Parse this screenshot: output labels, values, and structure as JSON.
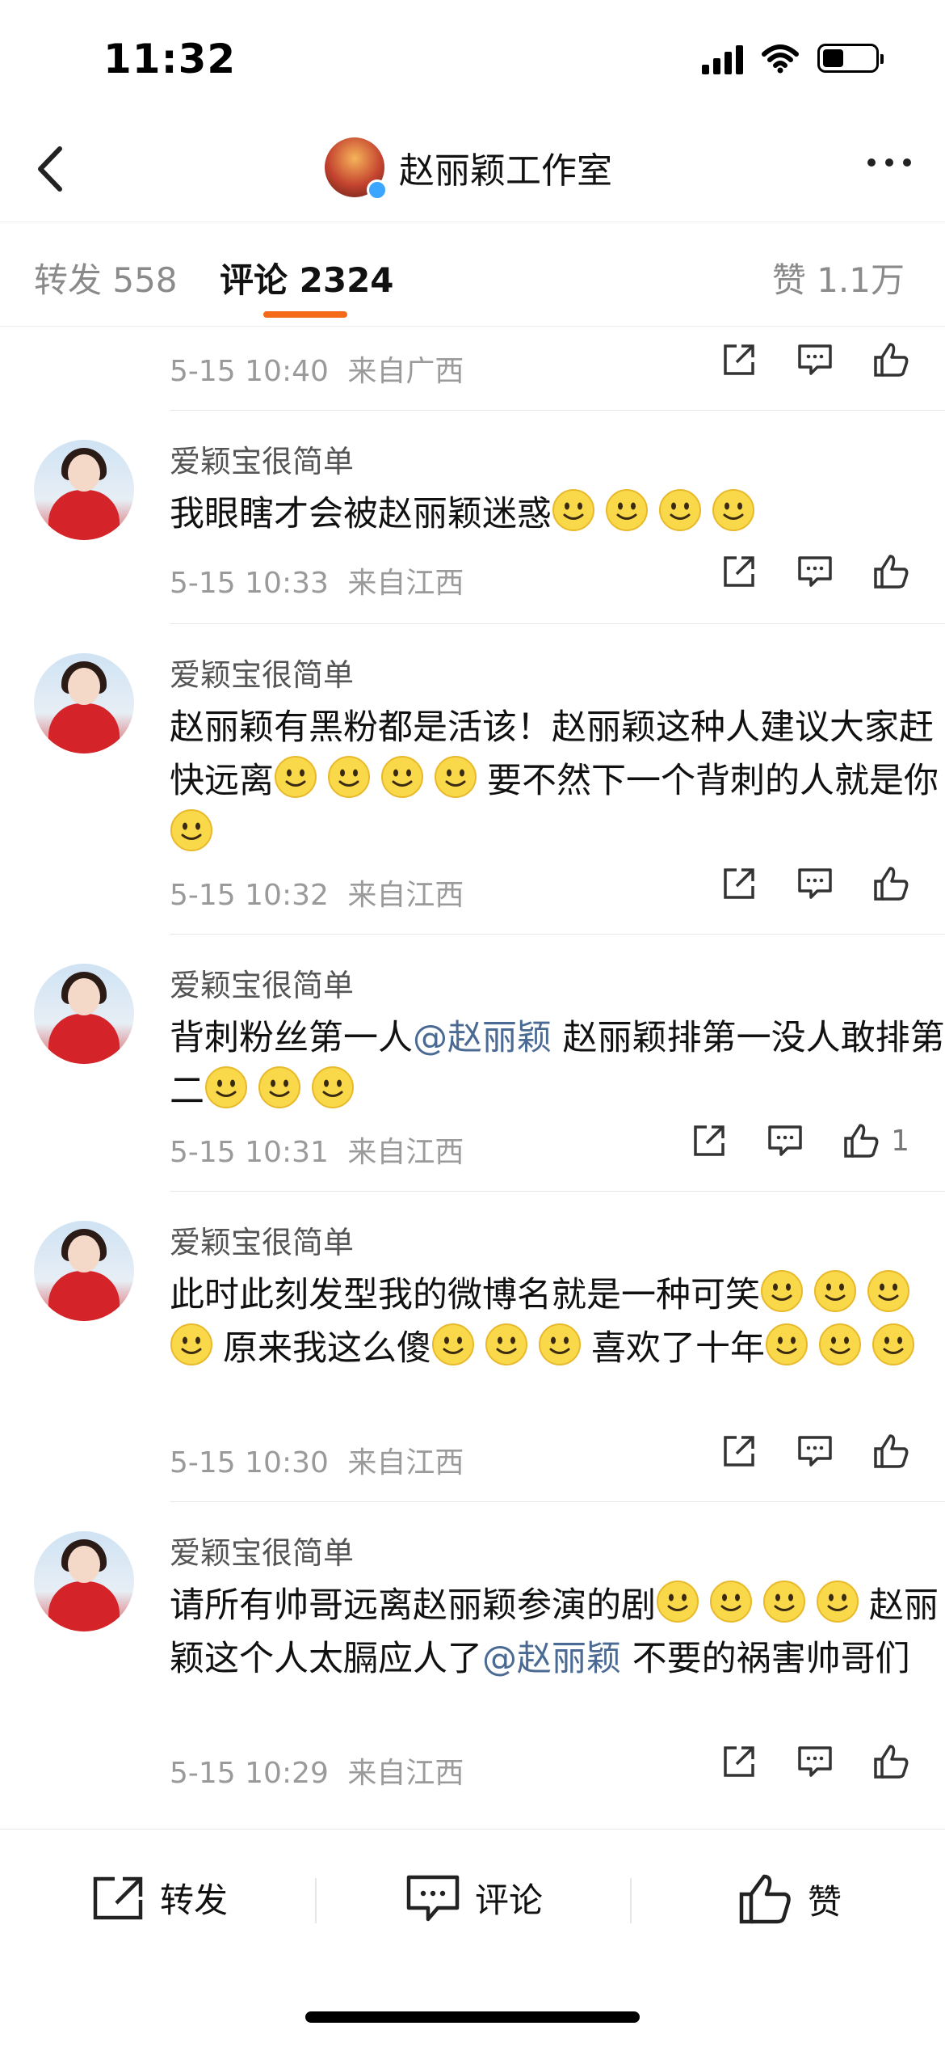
{
  "status_bar": {
    "time": "11:32",
    "battery_fraction": 0.4
  },
  "header": {
    "title": "赵丽颖工作室",
    "avatar_icon": "profile-avatar-icon",
    "verified_icon": "verified-badge-icon"
  },
  "tabs": {
    "repost": "转发 558",
    "comments": "评论 2324",
    "likes": "赞 1.1万"
  },
  "comments": [
    {
      "time": "5-15 10:40",
      "source": "来自广西"
    },
    {
      "username": "爱颖宝很简单",
      "text": "我眼瞎才会被赵丽颖迷惑",
      "emoji_after": 4,
      "time": "5-15 10:33",
      "source": "来自江西"
    },
    {
      "username": "爱颖宝很简单",
      "text_a": "赵丽颖有黑粉都是活该！赵丽颖这种人建议大家赶快远离",
      "emoji_mid": 4,
      "text_b": "要不然下一个背刺的人就是你",
      "emoji_after": 1,
      "time": "5-15 10:32",
      "source": "来自江西"
    },
    {
      "username": "爱颖宝很简单",
      "text_a": "背刺粉丝第一人",
      "mention": "@赵丽颖",
      "text_b": " 赵丽颖排第一没人敢排第二",
      "emoji_after": 3,
      "time": "5-15 10:31",
      "source": "来自江西",
      "like_count": "1"
    },
    {
      "username": "爱颖宝很简单",
      "text_a": "此时此刻发型我的微博名就是一种可笑",
      "emoji_mid1": 4,
      "text_b": "原来我这么傻",
      "emoji_mid2": 3,
      "text_c": "喜欢了十年",
      "emoji_after": 3,
      "time": "5-15 10:30",
      "source": "来自江西"
    },
    {
      "username": "爱颖宝很简单",
      "text_a": "请所有帅哥远离赵丽颖参演的剧",
      "emoji_mid": 4,
      "text_b": "赵丽颖这个人太膈应人了",
      "mention": "@赵丽颖",
      "text_c": " 不要的祸害帅哥们",
      "time": "5-15 10:29",
      "source": "来自江西"
    }
  ],
  "toolbar": {
    "repost": "转发",
    "comment": "评论",
    "like": "赞"
  },
  "colors": {
    "accent": "#f46a19",
    "mention": "#4a6a94",
    "verified": "#3aa6ff"
  }
}
